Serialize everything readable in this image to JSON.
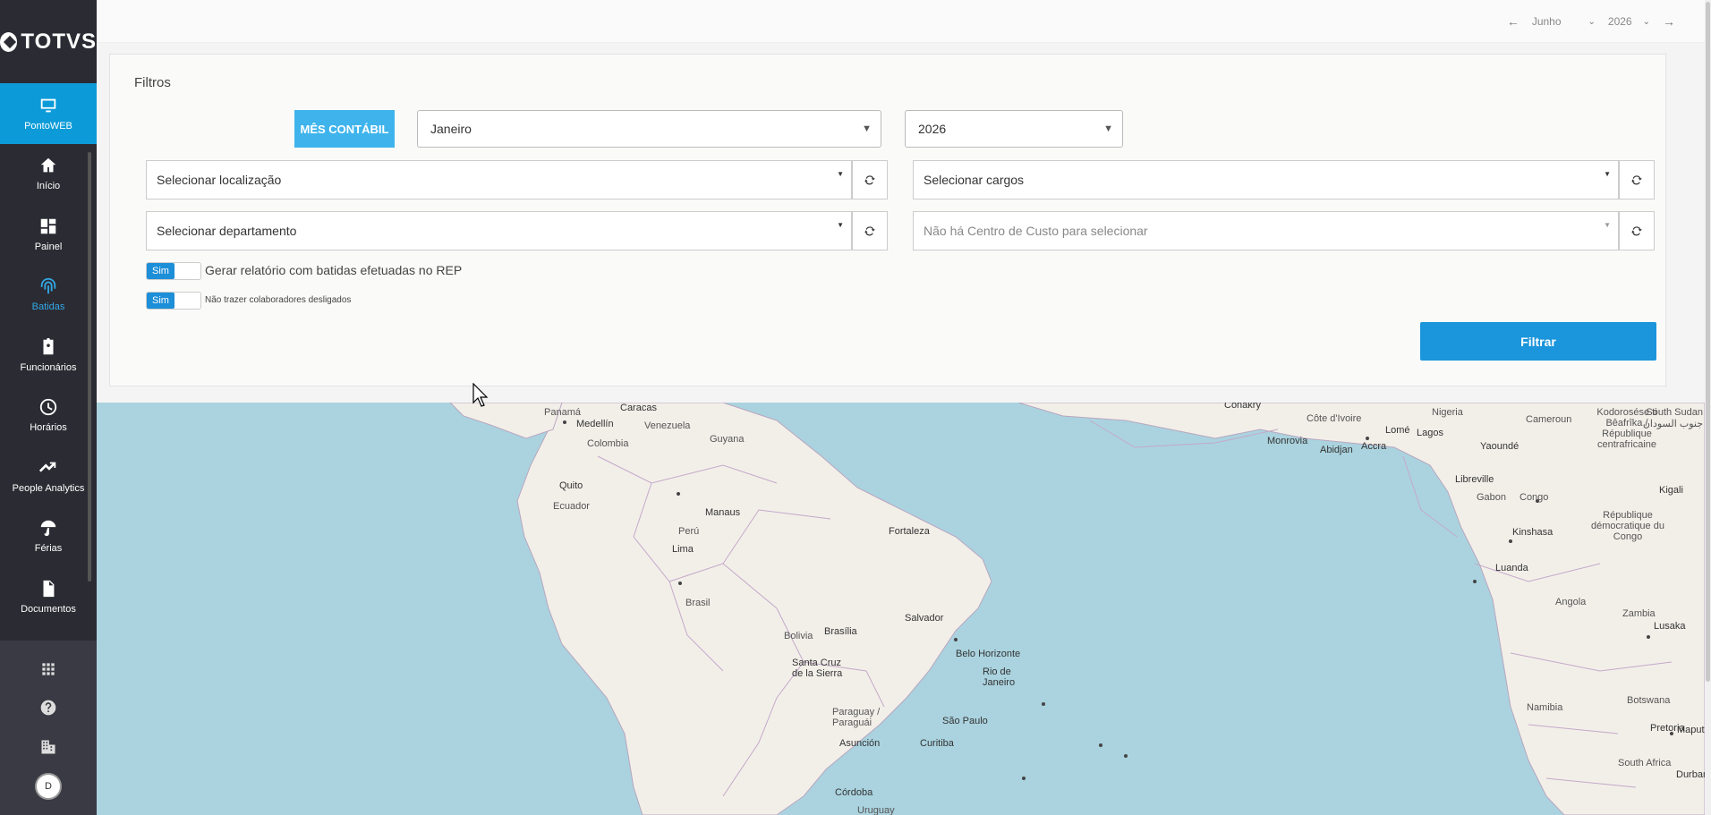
{
  "brand": {
    "logo_text": "TOTVS"
  },
  "sidebar": {
    "items": [
      {
        "label": "PontoWEB",
        "icon": "monitor-icon"
      },
      {
        "label": "Início",
        "icon": "home-icon"
      },
      {
        "label": "Painel",
        "icon": "dashboard-icon"
      },
      {
        "label": "Batidas",
        "icon": "fingerprint-icon"
      },
      {
        "label": "Funcionários",
        "icon": "clipboard-user-icon"
      },
      {
        "label": "Horários",
        "icon": "clock-icon"
      },
      {
        "label": "People Analytics",
        "icon": "trending-up-icon"
      },
      {
        "label": "Férias",
        "icon": "umbrella-icon"
      },
      {
        "label": "Documentos",
        "icon": "document-icon"
      }
    ],
    "bottom_icons": [
      "apps-grid-icon",
      "help-icon",
      "building-icon"
    ],
    "avatar_initial": "D"
  },
  "header": {
    "month": "Junho",
    "year": "2026"
  },
  "filters": {
    "title": "Filtros",
    "mes_contabil_label": "MÊS CONTÁBIL",
    "month_select": "Janeiro",
    "year_select": "2026",
    "localizacao_placeholder": "Selecionar localização",
    "cargos_placeholder": "Selecionar cargos",
    "departamento_placeholder": "Selecionar departamento",
    "centro_custo_placeholder": "Não há Centro de Custo para selecionar",
    "toggle1": {
      "state": "Sim",
      "label": "Gerar relatório com batidas efetuadas no REP"
    },
    "toggle2": {
      "state": "Sim",
      "label": "Não trazer colaboradores desligados"
    },
    "filter_button": "Filtrar"
  },
  "map": {
    "labels": {
      "panama": "Panamá",
      "caracas": "Caracas",
      "medellin": "Medellín",
      "venezuela": "Venezuela",
      "colombia": "Colombia",
      "guyana": "Guyana",
      "quito": "Quito",
      "ecuador": "Ecuador",
      "manaus": "Manaus",
      "fortaleza": "Fortaleza",
      "peru": "Perú",
      "lima": "Lima",
      "brasil": "Brasil",
      "brasilia": "Brasília",
      "salvador": "Salvador",
      "bolivia": "Bolivia",
      "santa_cruz": "Santa Cruz de la Sierra",
      "belo_horizonte": "Belo Horizonte",
      "rio": "Rio de Janeiro",
      "paraguay": "Paraguay / Paraguái",
      "sao_paulo": "São Paulo",
      "asuncion": "Asunción",
      "curitiba": "Curitiba",
      "cordoba": "Córdoba",
      "uruguay": "Uruguay",
      "conakry": "Conakry",
      "cote": "Côte d'Ivoire",
      "nigeria": "Nigeria",
      "cameroun": "Cameroun",
      "monrovia": "Monrovia",
      "abidjan": "Abidjan",
      "accra": "Accra",
      "lome": "Lomé",
      "lagos": "Lagos",
      "yaounde": "Yaoundé",
      "libreville": "Libreville",
      "gabon": "Gabon",
      "congo": "Congo",
      "kinshasa": "Kinshasa",
      "rdc": "République démocratique du Congo",
      "luanda": "Luanda",
      "angola": "Angola",
      "zambia": "Zambia",
      "lusaka": "Lusaka",
      "botswana": "Botswana",
      "namibia": "Namibia",
      "pretoria": "Pretoria",
      "maputo": "Maputo",
      "south_africa": "South Africa",
      "durban": "Durban",
      "kigali": "Kigali",
      "centrafrique": "Kodorosése ti Bêafrîka / République centrafricaine",
      "south_sudan": "South Sudan جنوب السودان"
    }
  }
}
